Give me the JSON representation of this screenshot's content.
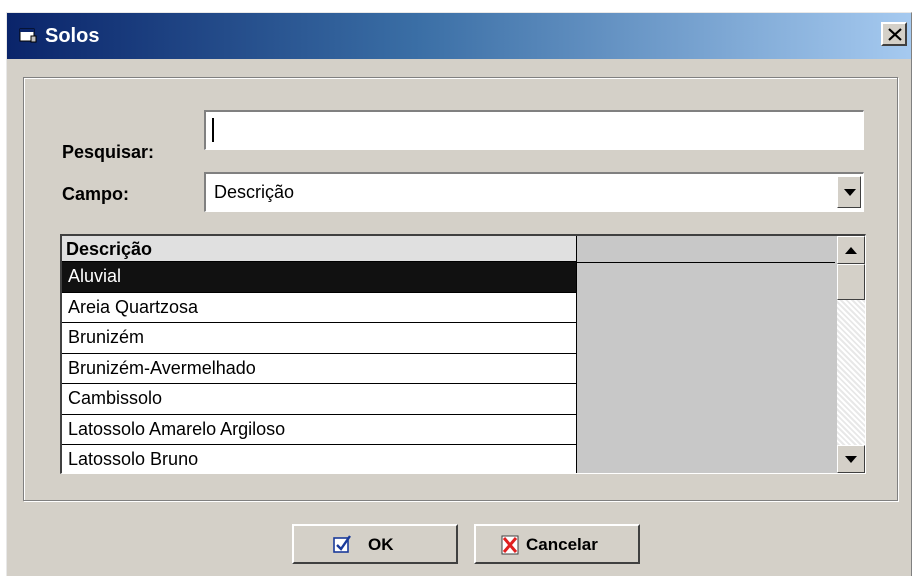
{
  "window": {
    "title": "Solos"
  },
  "search": {
    "label": "Pesquisar:",
    "value": ""
  },
  "field": {
    "label": "Campo:",
    "selected": "Descrição"
  },
  "grid": {
    "column_header": "Descrição",
    "rows": [
      "Aluvial",
      "Areia Quartzosa",
      "Brunizém",
      "Brunizém-Avermelhado",
      "Cambissolo",
      "Latossolo Amarelo Argiloso",
      "Latossolo Bruno"
    ],
    "selected_index": 0
  },
  "buttons": {
    "ok": "OK",
    "cancel": "Cancelar"
  },
  "icons": {
    "window": "window-icon",
    "close": "close-icon",
    "ok": "checkmark-icon",
    "cancel": "x-icon"
  },
  "colors": {
    "title_start": "#0a246a",
    "title_end": "#a6caf0",
    "selection": "#111111",
    "cancel_icon": "#e02020"
  }
}
